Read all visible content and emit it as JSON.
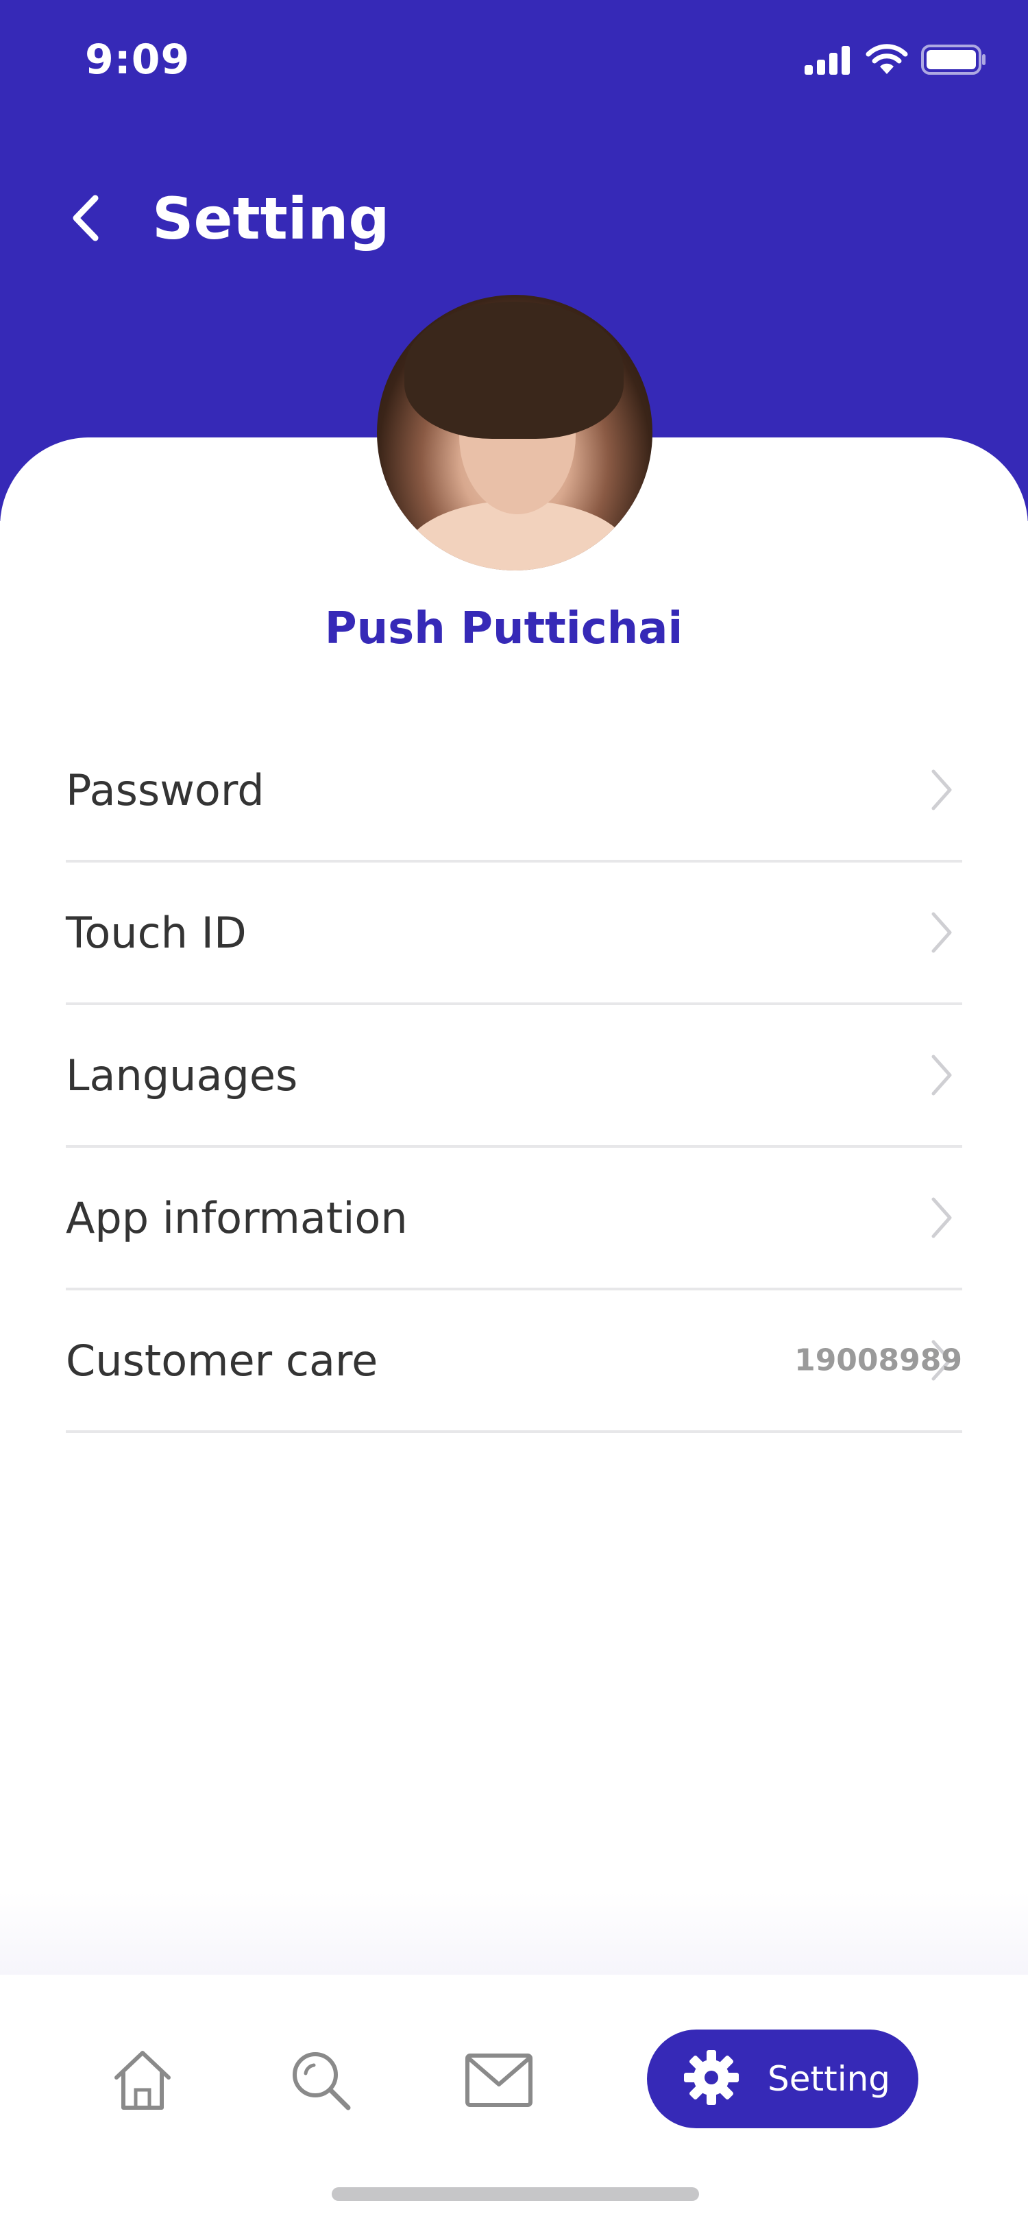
{
  "status_bar": {
    "time": "9:09"
  },
  "header": {
    "title": "Setting"
  },
  "profile": {
    "name": "Push Puttichai"
  },
  "settings_items": [
    {
      "label": "Password",
      "value": ""
    },
    {
      "label": "Touch ID",
      "value": ""
    },
    {
      "label": "Languages",
      "value": ""
    },
    {
      "label": "App information",
      "value": ""
    },
    {
      "label": "Customer care",
      "value": "19008989"
    }
  ],
  "tab_bar": {
    "tabs": [
      {
        "icon": "home-icon",
        "label": ""
      },
      {
        "icon": "search-icon",
        "label": ""
      },
      {
        "icon": "mail-icon",
        "label": ""
      },
      {
        "icon": "gear-icon",
        "label": "Setting",
        "active": true
      }
    ]
  },
  "colors": {
    "primary": "#3629b7",
    "text": "#343434",
    "divider": "#e7e7e9",
    "muted": "#9a9a9a"
  }
}
